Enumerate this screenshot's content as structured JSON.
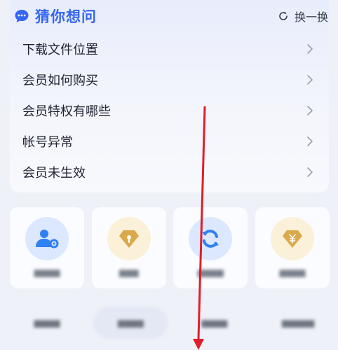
{
  "faq": {
    "title": "猜你想问",
    "refresh_label": "换一换",
    "items": [
      {
        "label": "下载文件位置"
      },
      {
        "label": "会员如何购买"
      },
      {
        "label": "会员特权有哪些"
      },
      {
        "label": "帐号异常"
      },
      {
        "label": "会员未生效"
      }
    ]
  },
  "services": {
    "tiles": [
      {
        "icon": "user-settings-icon",
        "color": "#2f80f4"
      },
      {
        "icon": "gold-diamond-icon",
        "color": "#d9a847"
      },
      {
        "icon": "sync-icon",
        "color": "#2f80f4"
      },
      {
        "icon": "yen-diamond-icon",
        "color": "#d9a847"
      }
    ]
  },
  "annotation": {
    "arrow_color": "#e01e2a"
  }
}
